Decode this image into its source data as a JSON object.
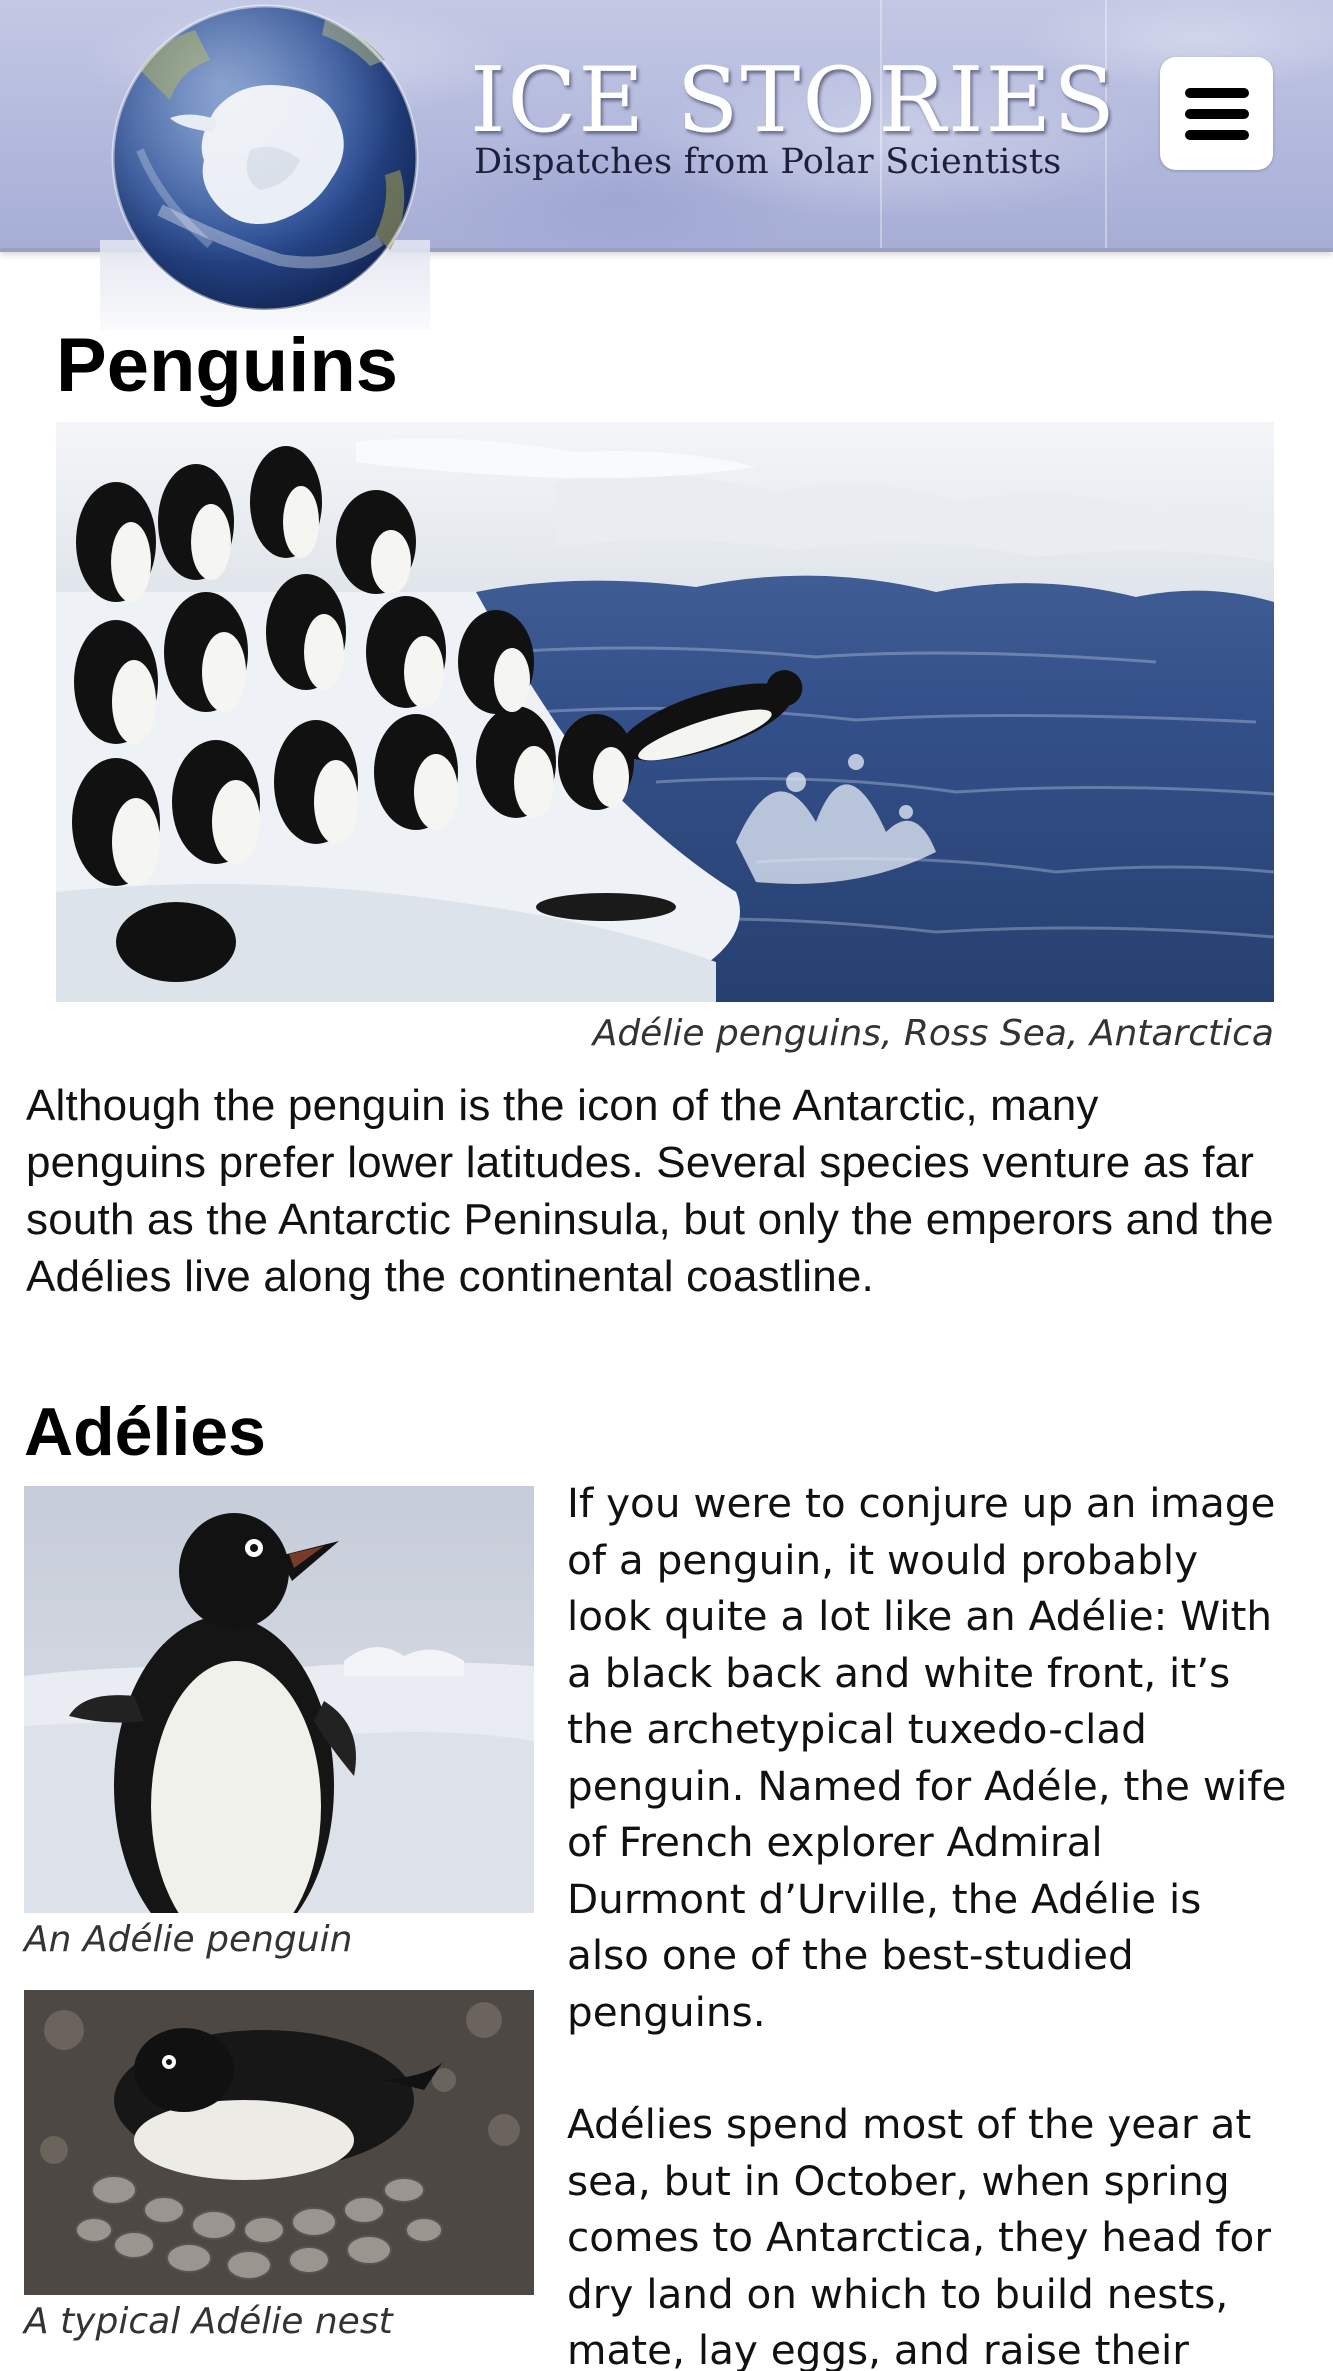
{
  "header": {
    "title": "ICE STORIES",
    "subtitle": "Dispatches from Polar Scientists",
    "menu_icon": "hamburger-menu-icon",
    "logo": "antarctica-globe-logo"
  },
  "colors": {
    "banner": "#b3b9dd",
    "banner_border": "#9aa0c6",
    "title_text": "#ffffff",
    "subtitle_text": "#1e1f3a",
    "body_text": "#111111"
  },
  "page": {
    "title": "Penguins",
    "hero_caption": "Adélie penguins, Ross Sea, Antarctica",
    "intro": "Although the penguin is the icon of the Antarctic, many penguins prefer lower latitudes. Several species venture as far south as the Antarctic Peninsula, but only the emperors and the Adélies live along the continental coastline."
  },
  "adelies": {
    "heading": "Adélies",
    "image1_caption": "An Adélie penguin",
    "image2_caption": "A typical Adélie nest",
    "paragraph1": "If you were to conjure up an image of a penguin, it would probably look quite a lot like an Adélie: With a black back and white front, it’s the archetypical tuxedo-clad penguin. Named for Adéle, the wife of French explorer Admiral Durmont d’Urville, the Adélie is also one of the best-studied penguins.",
    "paragraph2": "Adélies spend most of the year at sea, but in October, when spring comes to Antarctica, they head for dry land on which to build nests, mate, lay eggs, and raise their"
  }
}
